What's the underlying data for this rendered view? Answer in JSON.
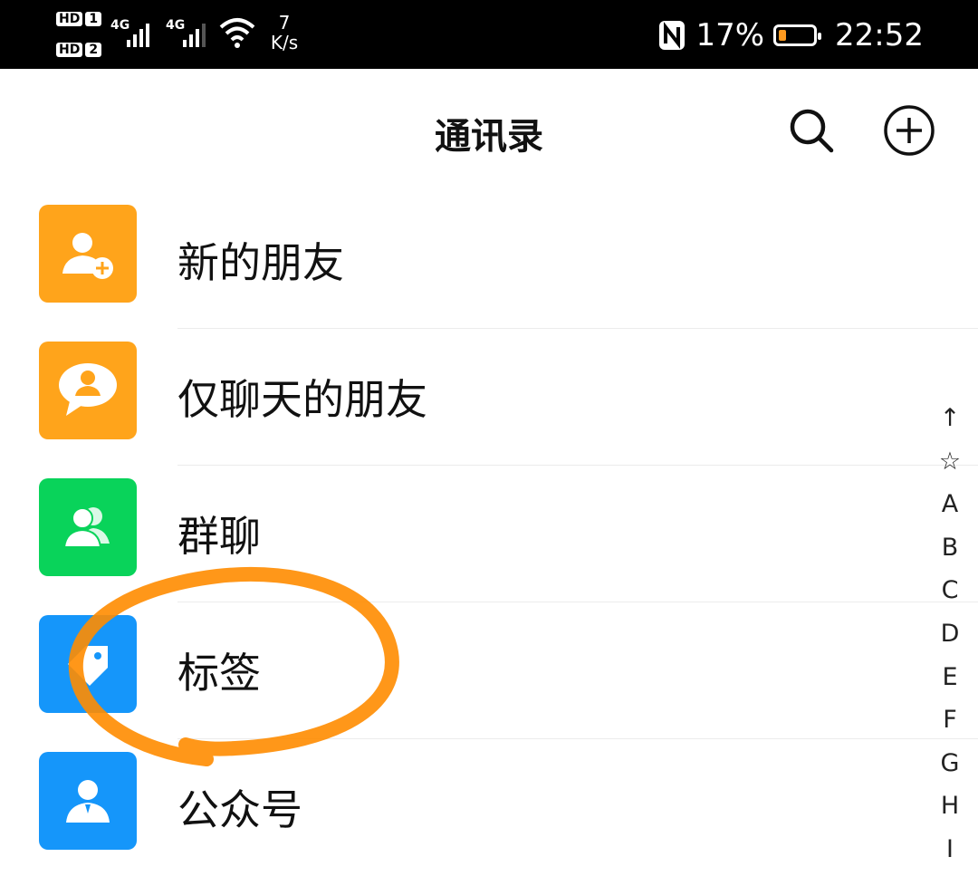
{
  "status_bar": {
    "hd1": "HD",
    "hd1_num": "1",
    "hd2": "HD",
    "hd2_num": "2",
    "sim1_type": "4G",
    "sim2_type": "4G",
    "speed_value": "7",
    "speed_unit": "K/s",
    "nfc_icon": "nfc-icon",
    "battery_percent": "17%",
    "battery_level": 0.17,
    "time": "22:52"
  },
  "header": {
    "title": "通讯录",
    "search_icon": "search-icon",
    "add_icon": "add-circle-icon"
  },
  "list": {
    "items": [
      {
        "label": "新的朋友",
        "icon": "add-friend-icon",
        "color": "#ffa41b"
      },
      {
        "label": "仅聊天的朋友",
        "icon": "chat-only-friend-icon",
        "color": "#ffa41b"
      },
      {
        "label": "群聊",
        "icon": "group-chat-icon",
        "color": "#09d35a"
      },
      {
        "label": "标签",
        "icon": "tag-icon",
        "color": "#1596fa"
      },
      {
        "label": "公众号",
        "icon": "official-account-icon",
        "color": "#1596fa"
      }
    ]
  },
  "alpha_index": [
    "↑",
    "☆",
    "A",
    "B",
    "C",
    "D",
    "E",
    "F",
    "G",
    "H",
    "I"
  ],
  "annotation": {
    "color": "#ff8c00",
    "target": "标签"
  }
}
